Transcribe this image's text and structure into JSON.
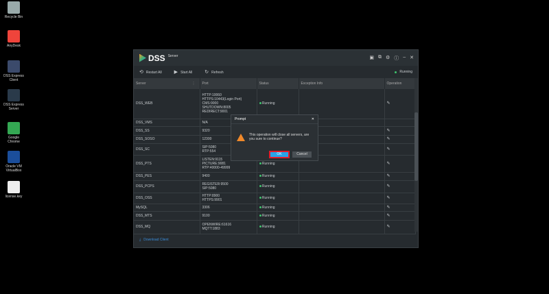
{
  "desktop": [
    {
      "label": "Recycle Bin",
      "color": "#9aa"
    },
    {
      "label": "AnyDesk",
      "color": "#ef443b"
    },
    {
      "label": "DSS Express Client",
      "color": "#3b4a6b"
    },
    {
      "label": "DSS Express Server",
      "color": "#2a3a4a"
    },
    {
      "label": "Google Chrome",
      "color": "#34a853"
    },
    {
      "label": "Oracle VM VirtualBox",
      "color": "#1b4e9b"
    },
    {
      "label": "license.key",
      "color": "#eee"
    }
  ],
  "window": {
    "brand": "DSS",
    "subtitle": "Server"
  },
  "toolbar": {
    "restart": "Restart All",
    "start": "Start All",
    "refresh": "Refresh",
    "status": "Running"
  },
  "columns": [
    "Server",
    "Port",
    "Status",
    "Exception Info",
    "Operation"
  ],
  "rows": [
    {
      "server": "DSS_WEB",
      "port": "HTTP:10060\nHTTPS:10443(Login Port)\nCMS:9000\nSHUTDOWN:8005\nREDIRECT:9001",
      "status": "Running",
      "edit": true
    },
    {
      "server": "DSS_VMS",
      "port": "N/A",
      "status": "",
      "edit": false
    },
    {
      "server": "DSS_SS",
      "port": "9320",
      "status": "",
      "edit": true
    },
    {
      "server": "DSS_SOSO",
      "port": "12300",
      "status": "",
      "edit": true
    },
    {
      "server": "DSS_SC",
      "port": "SIP:5080\nRTP:554",
      "status": "",
      "edit": true
    },
    {
      "server": "DSS_PTS",
      "port": "LISTEN:9115\nPICTURE:9081\nRTP:40000-49999",
      "status": "Running",
      "edit": true
    },
    {
      "server": "DSS_PES",
      "port": "9400",
      "status": "Running",
      "edit": true
    },
    {
      "server": "DSS_PCPS",
      "port": "REGISTER:9500\nSIP:5080",
      "status": "Running",
      "edit": true
    },
    {
      "server": "DSS_OSS",
      "port": "HTTP:8900\nHTTPS:9901",
      "status": "Running",
      "edit": true
    },
    {
      "server": "MySQL",
      "port": "3306",
      "status": "Running",
      "edit": true
    },
    {
      "server": "DSS_MTS",
      "port": "9100",
      "status": "Running",
      "edit": true
    },
    {
      "server": "DSS_MQ",
      "port": "OPENWIRE:61616\nMQTT:1883",
      "status": "Running",
      "edit": true
    }
  ],
  "footer": {
    "download": "Download Client"
  },
  "dialog": {
    "title": "Prompt",
    "message": "This operation will close all servers, are you sure to continue?",
    "ok": "OK",
    "cancel": "Cancel"
  }
}
